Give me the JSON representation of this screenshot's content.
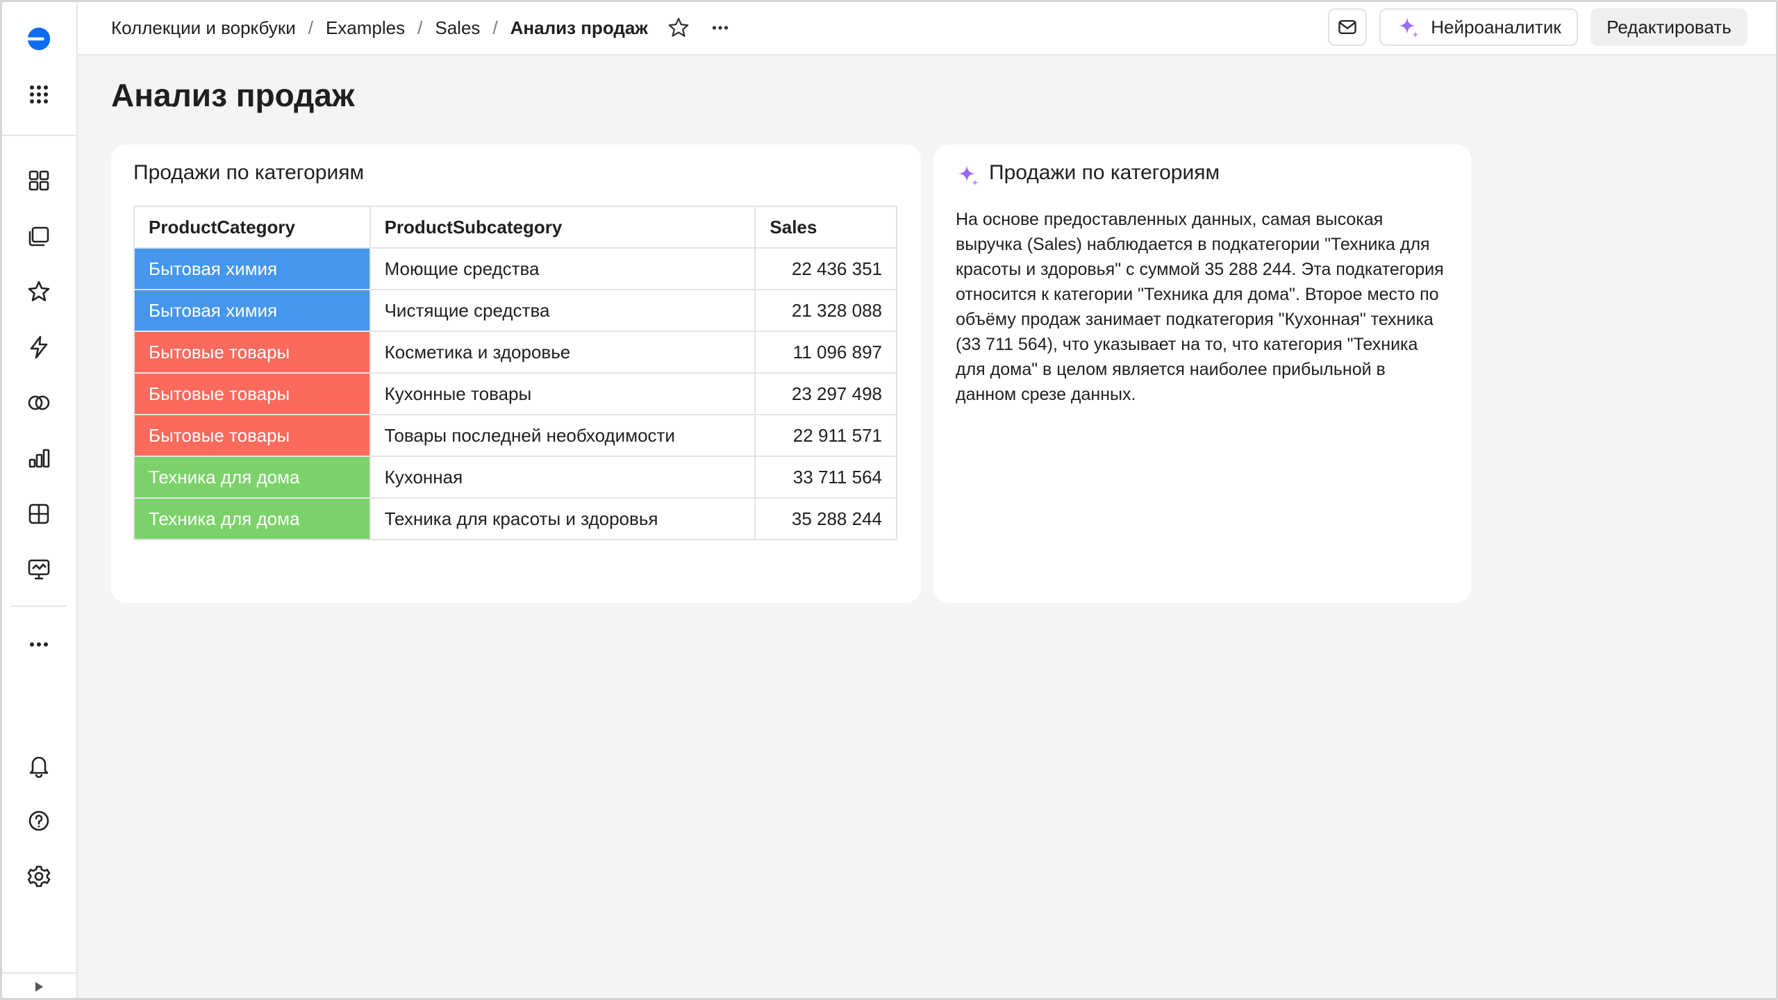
{
  "breadcrumbs": [
    {
      "label": "Коллекции и воркбуки"
    },
    {
      "label": "Examples"
    },
    {
      "label": "Sales"
    },
    {
      "label": "Анализ продаж"
    }
  ],
  "breadcrumb_separator": "/",
  "header": {
    "ai_button_label": "Нейроаналитик",
    "edit_button_label": "Редактировать"
  },
  "page": {
    "title": "Анализ продаж"
  },
  "table_widget": {
    "title": "Продажи по категориям",
    "columns": [
      "ProductCategory",
      "ProductSubcategory",
      "Sales"
    ],
    "rows": [
      {
        "category": "Бытовая химия",
        "subcategory": "Моющие средства",
        "sales": "22 436 351",
        "color": "#4596ec"
      },
      {
        "category": "Бытовая химия",
        "subcategory": "Чистящие средства",
        "sales": "21 328 088",
        "color": "#4596ec"
      },
      {
        "category": "Бытовые товары",
        "subcategory": "Косметика и здоровье",
        "sales": "11 096 897",
        "color": "#fb6a5d"
      },
      {
        "category": "Бытовые товары",
        "subcategory": "Кухонные товары",
        "sales": "23 297 498",
        "color": "#fb6a5d"
      },
      {
        "category": "Бытовые товары",
        "subcategory": "Товары последней необходимости",
        "sales": "22 911 571",
        "color": "#fb6a5d"
      },
      {
        "category": "Техника для дома",
        "subcategory": "Кухонная",
        "sales": "33 711 564",
        "color": "#7cd26a"
      },
      {
        "category": "Техника для дома",
        "subcategory": "Техника для красоты и здоровья",
        "sales": "35 288 244",
        "color": "#7cd26a"
      }
    ]
  },
  "insight_widget": {
    "title": "Продажи по категориям",
    "text": "На основе предоставленных данных, самая высокая выручка (Sales) наблюдается в подкатегории \"Техника для красоты и здоровья\" с суммой 35 288 244. Эта подкатегория относится к категории \"Техника для дома\". Второе место по объёму продаж занимает подкатегория \"Кухонная\" техника (33 711 564), что указывает на то, что категория \"Техника для дома\" в целом является наиболее прибыльной в данном срезе данных."
  },
  "colors": {
    "brand": "#0d6cf2",
    "ai_accent": "#9b6bf5",
    "chemistry": "#4596ec",
    "household": "#fb6a5d",
    "appliances": "#7cd26a"
  },
  "icons": {
    "sidebar": [
      "logo-icon",
      "apps-grid-icon",
      "collections-icon",
      "workbooks-icon",
      "favorites-icon",
      "lightning-icon",
      "connections-icon",
      "charts-icon",
      "dashboards-icon",
      "reports-icon",
      "more-icon",
      "notifications-icon",
      "help-icon",
      "settings-icon",
      "collapse-icon"
    ],
    "header": [
      "star-icon",
      "more-icon",
      "mail-icon",
      "sparkle-icon"
    ]
  }
}
